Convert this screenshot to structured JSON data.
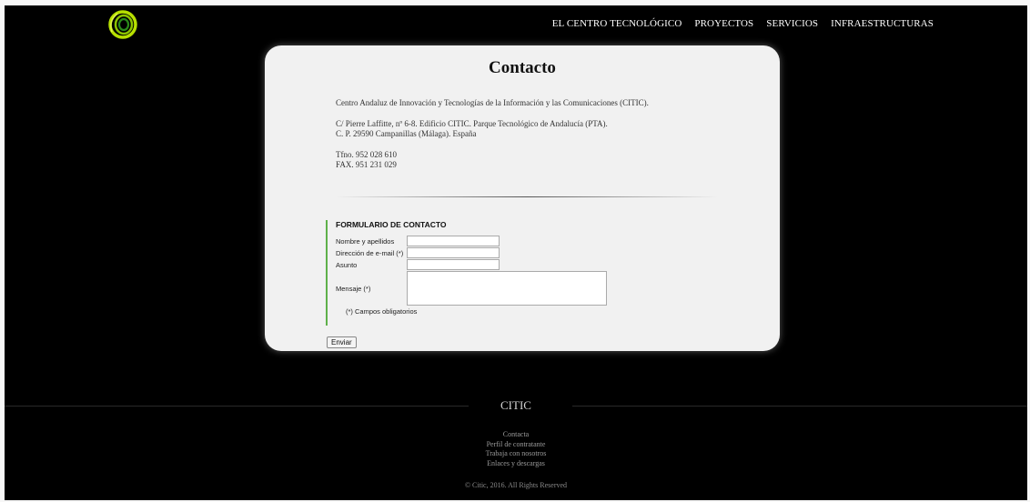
{
  "header": {
    "nav": [
      "EL CENTRO TECNOLÓGICO",
      "PROYECTOS",
      "SERVICIOS",
      "INFRAESTRUCTURAS"
    ]
  },
  "colors": {
    "background": "#000000",
    "card": "#f1f1f1",
    "accent": "#5fb04a",
    "logo_outer": "#b7e000",
    "logo_inner": "#2a8a1a"
  },
  "icons": {
    "logo": "citic-swirl-logo"
  },
  "contact": {
    "title": "Contacto",
    "org": "Centro Andaluz de Innovación y Tecnologías de la Información y las Comunicaciones (CITIC).",
    "address1": "C/ Pierre Laffitte, nº 6-8. Edificio CITIC. Parque Tecnológico de Andalucía (PTA).",
    "address2": "C. P. 29590 Campanillas (Málaga). España",
    "phone": "Tfno. 952 028 610",
    "fax": "FAX. 951 231 029"
  },
  "form": {
    "title": "FORMULARIO DE CONTACTO",
    "name_label": "Nombre y apellidos",
    "email_label": "Dirección de e-mail (*)",
    "subject_label": "Asunto",
    "message_label": "Mensaje (*)",
    "required_note": "(*) Campos obligatorios",
    "submit": "Enviar"
  },
  "footer": {
    "brand": "CITIC",
    "links": [
      "Contacta",
      "Perfil de contratante",
      "Trabaja con nosotros",
      "Enlaces y descargas"
    ],
    "copyright": "© Citic, 2016. All Rights Reserved"
  }
}
